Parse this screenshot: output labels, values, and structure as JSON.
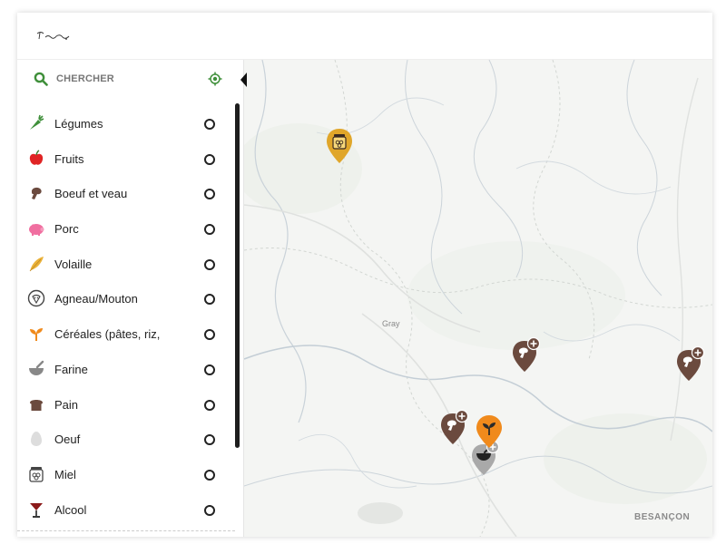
{
  "header": {
    "logo_text": "Terroir Local"
  },
  "search": {
    "label": "CHERCHER"
  },
  "categories": [
    {
      "label": "Légumes",
      "icon": "carrot-icon"
    },
    {
      "label": "Fruits",
      "icon": "apple-icon"
    },
    {
      "label": "Boeuf et veau",
      "icon": "beef-icon"
    },
    {
      "label": "Porc",
      "icon": "pig-icon"
    },
    {
      "label": "Volaille",
      "icon": "feather-icon"
    },
    {
      "label": "Agneau/Mouton",
      "icon": "sheep-icon"
    },
    {
      "label": "Céréales (pâtes, riz,",
      "icon": "sprout-icon"
    },
    {
      "label": "Farine",
      "icon": "mortar-icon"
    },
    {
      "label": "Pain",
      "icon": "bread-icon"
    },
    {
      "label": "Oeuf",
      "icon": "egg-icon"
    },
    {
      "label": "Miel",
      "icon": "honey-jar-icon"
    },
    {
      "label": "Alcool",
      "icon": "cocktail-glass-icon"
    }
  ],
  "map": {
    "places": {
      "gray": "Gray",
      "besancon": "BESANÇON"
    }
  },
  "colors": {
    "accent_green": "#3f8f3a",
    "marker_brown": "#6b4a3e",
    "marker_gold": "#e0a62a",
    "marker_orange": "#f08a1c",
    "marker_grey": "#a9a9a9"
  }
}
